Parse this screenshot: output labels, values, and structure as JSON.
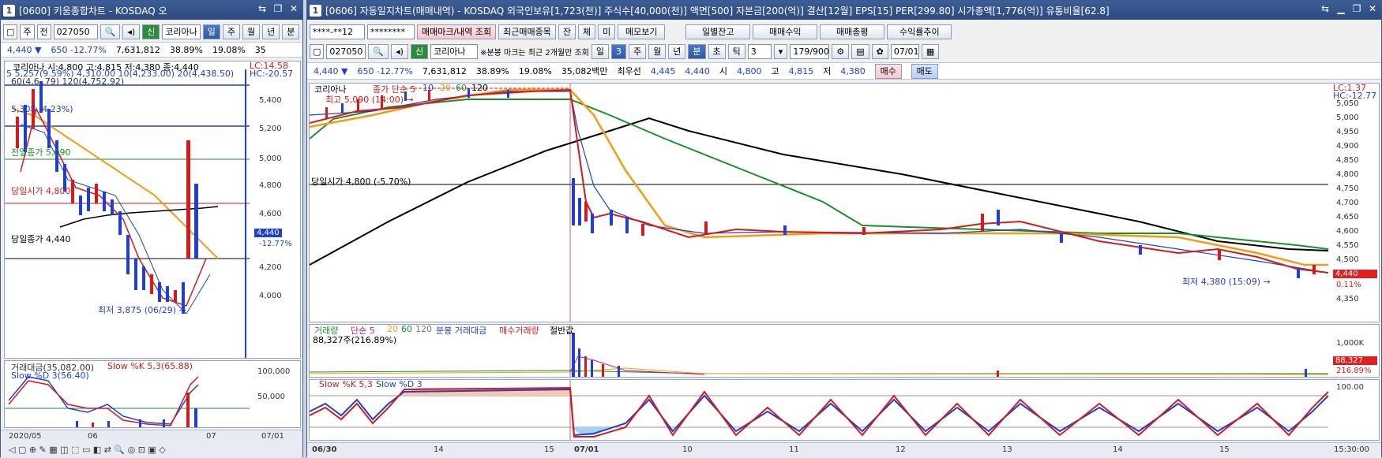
{
  "left": {
    "title_num": "1",
    "title": "[0600] 키움종합차트 - KOSDAQ 오",
    "toolbar": {
      "period": "주",
      "prev": "전",
      "code": "027050",
      "logo": "신",
      "name": "코리아나",
      "tabs": [
        "일",
        "주",
        "월",
        "년",
        "분"
      ],
      "active_tab": "일"
    },
    "quote": {
      "price": "4,440",
      "change": "650",
      "rate": "-12.77%",
      "volume": "7,631,812",
      "ratio1": "38.89%",
      "ratio2": "19.08%",
      "extra": "35"
    },
    "chart": {
      "legend_line1": "코리아나 시:4,800 고:4,815 저:4,380 종:4,440",
      "legend_line2": "5 5,257(9.59%) 4,310.00 10(4,233.00) 20(4,438.50)",
      "legend_line3": "60(4,6..79) 120(4,752.92)",
      "lc": "LC:14.58",
      "hc": "HC:-20.57",
      "price_ticks": [
        "5,400",
        "5,200",
        "5,000",
        "4,800",
        "4,600",
        "4,400",
        "4,200",
        "4,000"
      ],
      "label_high": "5,308 (4.23%)",
      "label_prev_close_red": "전일종가 5,090",
      "label_open": "당일시가 4,800",
      "label_prev_close": "당일종가 4,440",
      "label_low": "최저 3,875 (06/29) →",
      "price_tag": "4,440",
      "price_tag_rate": "-12.77%",
      "volume_legend": "거래대금(35,082.00)",
      "slow_legend": "Slow %K 5,3(65.88)",
      "slow_d_legend": "Slow %D 3(56.40)",
      "vol_ticks": [
        "100,000",
        "50,000"
      ],
      "dates": [
        "2020/05",
        "06",
        "07",
        "07/01"
      ]
    }
  },
  "right": {
    "title_num": "1",
    "title": "[0606] 자동일지차트(매매내역) - KOSDAQ 외국인보유[1,723(천)] 주식수[40,000(천)] 액면[500] 자본금[200(억)] 결산[12월] EPS[15] PER[299.80] 시가총액[1,776(억)] 유통비율[62.8]",
    "toolbar1": {
      "account": "****-**12",
      "password": "********",
      "btn_mark": "매매마크/내역 조회",
      "btn_recent": "최근매매종목",
      "chk1": "잔",
      "chk2": "체",
      "chk3": "미",
      "btn_memo": "메모보기",
      "btn_daily": "일별잔고",
      "btn_profit": "매매수익",
      "btn_total": "매매총평",
      "btn_trend": "수익률추이"
    },
    "toolbar2": {
      "code": "027050",
      "logo": "신",
      "name": "코리아나",
      "note": "※분봉 마크는 최근 2개월만 조회",
      "period_sel": "일",
      "period_num": "3",
      "tabs": [
        "주",
        "월",
        "년",
        "분",
        "초",
        "틱"
      ],
      "active_tab": "분",
      "minute": "3",
      "page": "179/900",
      "date": "07/01"
    },
    "quote": {
      "price": "4,440",
      "change": "650",
      "rate": "-12.77%",
      "volume": "7,631,812",
      "ratio1": "38.89%",
      "ratio2": "19.08%",
      "amount": "35,082백만",
      "best_bid_label": "최우선",
      "best_bid": "4,445",
      "best_ask": "4,440",
      "open_label": "시",
      "open": "4,800",
      "high_label": "고",
      "high": "4,815",
      "low_label": "저",
      "low": "4,380",
      "buy": "매수",
      "sell": "매도"
    },
    "chart": {
      "legend": "코리아나",
      "ma_legend": [
        "종가 단순 5",
        "10",
        "20",
        "60",
        "120"
      ],
      "max_label": "최고 5,090 (14:00) →",
      "open_label": "당일시가 4,800 (-5.70%)",
      "min_label": "최저 4,380 (15:09) →",
      "lc": "LC:1.37",
      "hc": "HC:-12.77",
      "price_ticks": [
        "5,050",
        "5,000",
        "4,950",
        "4,900",
        "4,850",
        "4,800",
        "4,750",
        "4,700",
        "4,650",
        "4,600",
        "4,550",
        "4,500",
        "4,450",
        "4,400",
        "4,350"
      ],
      "price_tag": "4,440",
      "price_tag_rate": "0.11%",
      "vol_legend": [
        "거래량",
        "단순 5",
        "20",
        "60",
        "120",
        "분봉 거래대금",
        "매수거래량",
        "절반값"
      ],
      "vol_value": "88,327주(216.89%)",
      "vol_ticks": [
        "1,000K"
      ],
      "vol_tag": "88,327",
      "vol_tag_rate": "216.89%",
      "slow_legend": "Slow %K 5,3",
      "slow_d_legend": "Slow %D 3",
      "slow_ticks": [
        "100.00"
      ],
      "dates": [
        "06/30",
        "14",
        "15",
        "07/01",
        "10",
        "11",
        "12",
        "13",
        "14",
        "15"
      ],
      "end_time": "15:30:00"
    }
  }
}
